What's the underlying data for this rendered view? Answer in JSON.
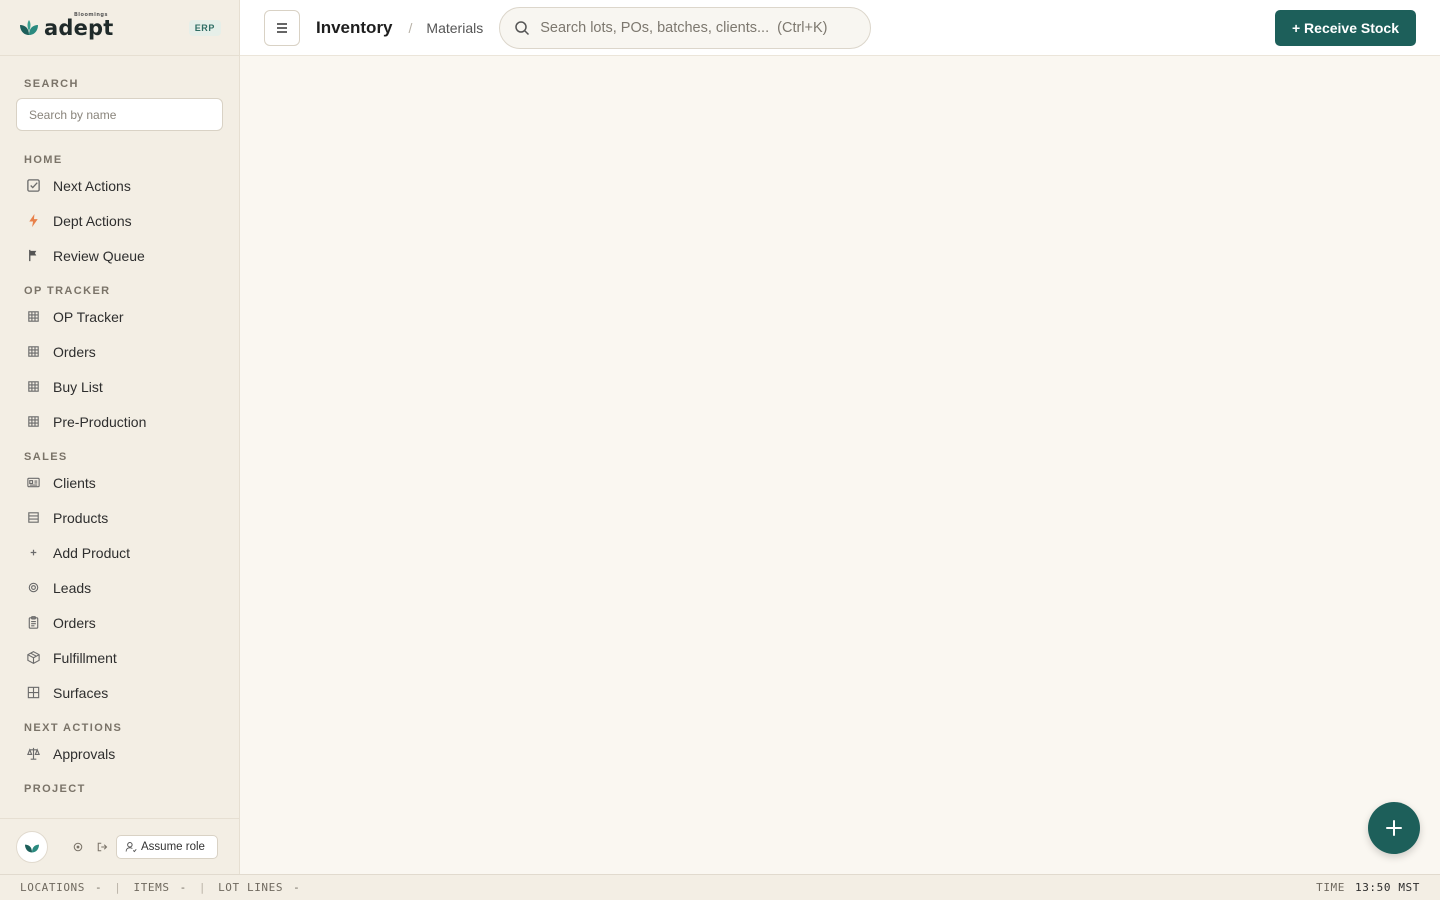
{
  "brand": {
    "name": "adept",
    "sub": "Bloomings",
    "badge": "ERP"
  },
  "sidebar": {
    "search_label": "SEARCH",
    "search_placeholder": "Search by name",
    "sections": {
      "home": {
        "label": "HOME",
        "items": [
          "Next Actions",
          "Dept Actions",
          "Review Queue"
        ]
      },
      "op_tracker": {
        "label": "OP TRACKER",
        "items": [
          "OP Tracker",
          "Orders",
          "Buy List",
          "Pre-Production"
        ]
      },
      "sales": {
        "label": "SALES",
        "items": [
          "Clients",
          "Products",
          "Add Product",
          "Leads",
          "Orders",
          "Fulfillment",
          "Surfaces"
        ]
      },
      "next_actions": {
        "label": "NEXT ACTIONS",
        "items": [
          "Approvals"
        ]
      },
      "project": {
        "label": "PROJECT"
      }
    },
    "footer": {
      "assume_role": "Assume role"
    }
  },
  "header": {
    "title": "Inventory",
    "separator": "/",
    "subtitle": "Materials",
    "search_placeholder": "Search lots, POs, batches, clients...  (Ctrl+K)",
    "receive_button": "+ Receive Stock"
  },
  "statusbar": {
    "locations_label": "LOCATIONS",
    "locations_value": "-",
    "items_label": "ITEMS",
    "items_value": "-",
    "lot_lines_label": "LOT LINES",
    "lot_lines_value": "-",
    "time_label": "TIME",
    "time_value": "13:50 MST"
  },
  "colors": {
    "accent": "#1d5f5a",
    "sidebar_bg": "#f3eee4",
    "main_bg": "#faf7f1",
    "dept_icon": "#e8814a"
  }
}
